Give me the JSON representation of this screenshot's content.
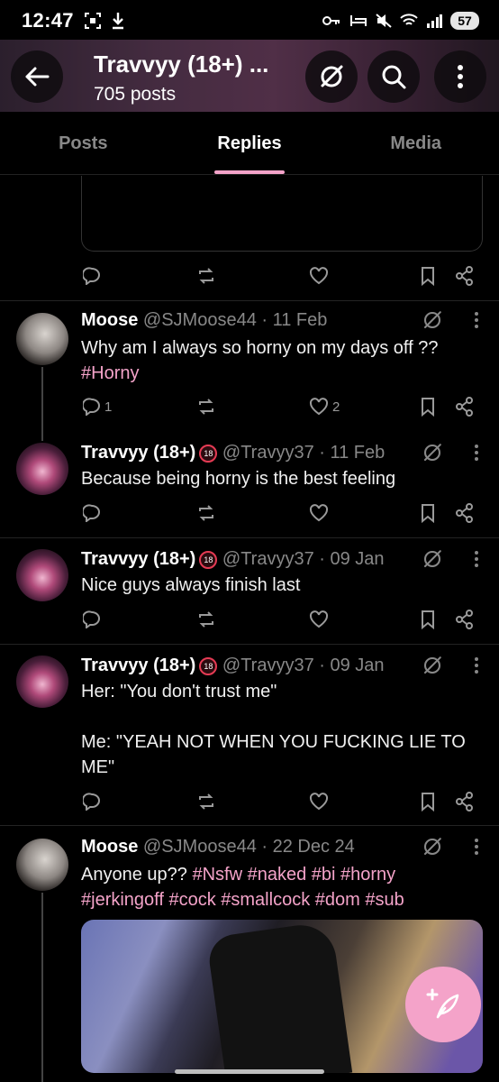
{
  "status": {
    "time": "12:47",
    "battery": "57"
  },
  "header": {
    "title": "Travvyy (18+) ...",
    "posts_count": "705 posts"
  },
  "tabs": [
    {
      "label": "Posts"
    },
    {
      "label": "Replies"
    },
    {
      "label": "Media"
    }
  ],
  "top_actions": {
    "reply_count": "",
    "like_count": ""
  },
  "posts": [
    {
      "name": "Moose",
      "handle": "@SJMoose44 · 11 Feb",
      "text": "Why am I always so horny on my days off ??",
      "tag": "#Horny",
      "reply_count": "1",
      "like_count": "2"
    },
    {
      "name": "Travvyy (18+)",
      "badge": "18",
      "handle": "@Travyy37 · 11 Feb",
      "text": "Because being horny is the best feeling"
    },
    {
      "name": "Travvyy (18+)",
      "badge": "18",
      "handle": "@Travyy37 · 09 Jan",
      "text": "Nice guys always finish last"
    },
    {
      "name": "Travvyy (18+)",
      "badge": "18",
      "handle": "@Travyy37 · 09 Jan",
      "line1": "Her: \"You don't trust me\"",
      "line2": "Me: \"YEAH NOT WHEN YOU FUCKING LIE TO ME\""
    },
    {
      "name": "Moose",
      "handle": "@SJMoose44 · 22 Dec 24",
      "text": "Anyone up??",
      "tags1": "#Nsfw #naked #bi #horny",
      "tags2": "#jerkingoff #cock #smallcock #dom #sub"
    }
  ],
  "colors": {
    "accent": "#f4a3c9",
    "background": "#000000",
    "muted": "#888888"
  },
  "icons": [
    "back-arrow-icon",
    "unfollow-icon",
    "search-icon",
    "more-icon",
    "reply-icon",
    "repost-icon",
    "like-icon",
    "bookmark-icon",
    "share-icon",
    "compose-icon"
  ]
}
